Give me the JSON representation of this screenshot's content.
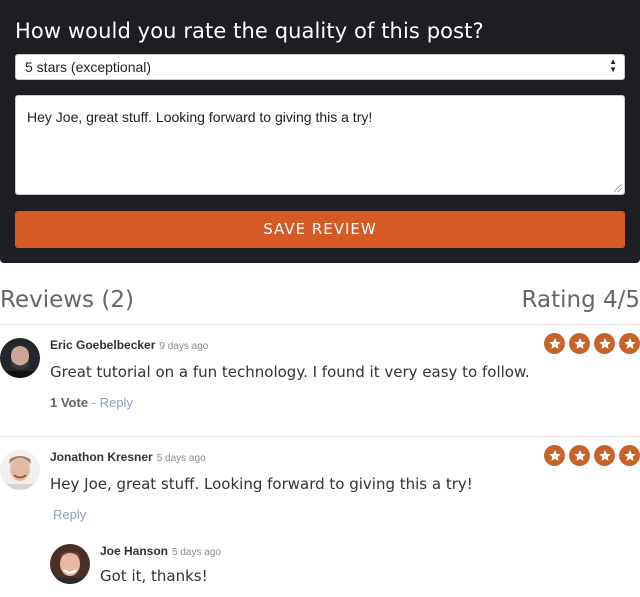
{
  "form": {
    "question": "How would you rate the quality of this post?",
    "rating_selected": "5 stars (exceptional)",
    "comment_value": "Hey Joe, great stuff. Looking forward to giving this a try!",
    "save_label": "SAVE REVIEW"
  },
  "reviews_header": {
    "title": "Reviews (2)",
    "rating": "Rating 4/5"
  },
  "reviews": [
    {
      "author": "Eric Goebelbecker",
      "time": "9 days ago",
      "text": "Great tutorial on a fun technology. I found it very easy to follow.",
      "votes": "1 Vote",
      "separator": " - ",
      "reply": "Reply",
      "stars": 4
    },
    {
      "author": "Jonathon Kresner",
      "time": "5 days ago",
      "text": "Hey Joe, great stuff. Looking forward to giving this a try!",
      "reply": "Reply",
      "stars": 4,
      "replies": [
        {
          "author": "Joe Hanson",
          "time": "5 days ago",
          "text": "Got it, thanks!"
        }
      ]
    }
  ],
  "colors": {
    "form_bg": "#1c1e24",
    "accent": "#d55a25",
    "star": "#c7622b"
  }
}
